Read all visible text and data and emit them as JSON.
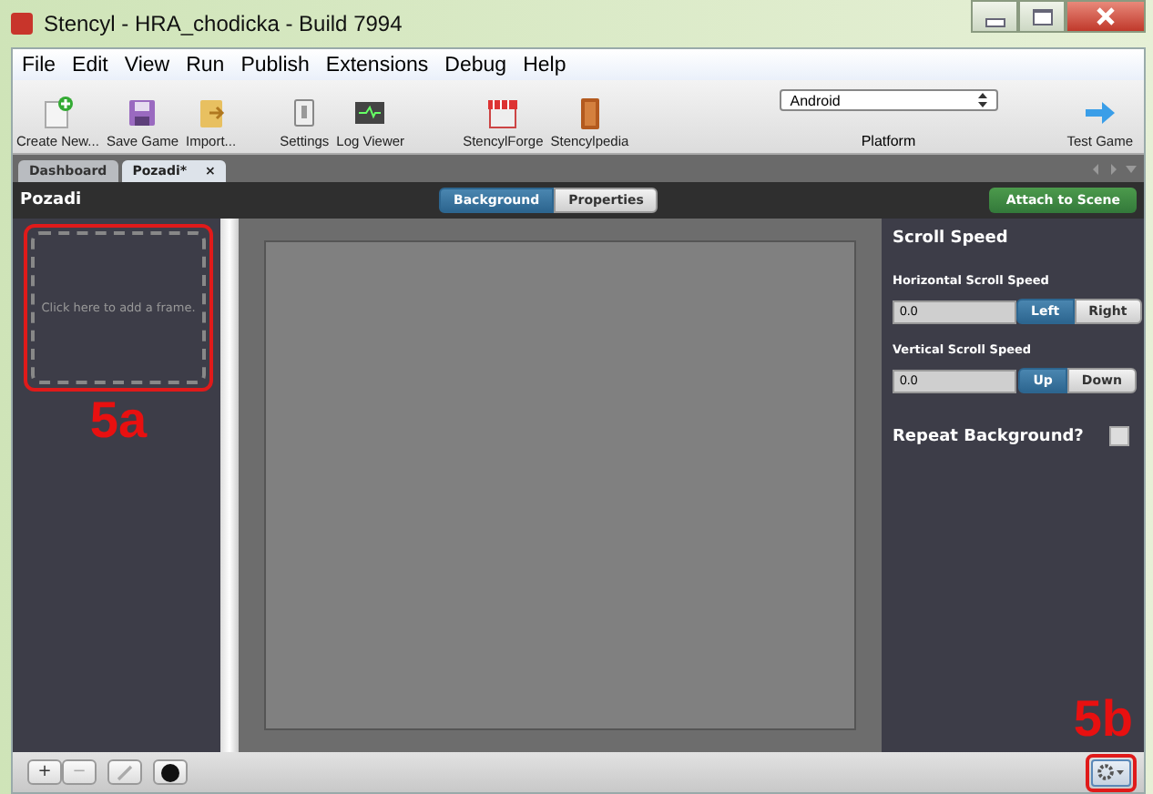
{
  "window": {
    "title": "Stencyl - HRA_chodicka - Build 7994"
  },
  "menu": [
    "File",
    "Edit",
    "View",
    "Run",
    "Publish",
    "Extensions",
    "Debug",
    "Help"
  ],
  "toolbar": [
    {
      "label": "Create New...",
      "kind": "new"
    },
    {
      "label": "Save Game",
      "kind": "save"
    },
    {
      "label": "Import...",
      "kind": "import"
    },
    {
      "label": "Settings",
      "kind": "settings"
    },
    {
      "label": "Log Viewer",
      "kind": "log"
    },
    {
      "label": "StencylForge",
      "kind": "forge"
    },
    {
      "label": "Stencylpedia",
      "kind": "book"
    }
  ],
  "platform": {
    "value": "Android",
    "label": "Platform"
  },
  "test_game": "Test Game",
  "tabs": [
    {
      "label": "Dashboard",
      "selected": false
    },
    {
      "label": "Pozadi*",
      "selected": true,
      "close": "×"
    }
  ],
  "header": {
    "title": "Pozadi",
    "views": [
      {
        "label": "Background",
        "selected": true
      },
      {
        "label": "Properties",
        "selected": false
      }
    ],
    "attach": "Attach to Scene"
  },
  "frames": {
    "placeholder": "Click here to add a frame."
  },
  "properties": {
    "title": "Scroll Speed",
    "horizontal": {
      "label": "Horizontal Scroll Speed",
      "value": "0.0",
      "options": [
        {
          "label": "Left",
          "selected": true
        },
        {
          "label": "Right",
          "selected": false
        }
      ]
    },
    "vertical": {
      "label": "Vertical Scroll Speed",
      "value": "0.0",
      "options": [
        {
          "label": "Up",
          "selected": true
        },
        {
          "label": "Down",
          "selected": false
        }
      ]
    },
    "repeat": {
      "label": "Repeat Background?",
      "checked": false
    }
  },
  "bottom_tools": [
    {
      "label": "+",
      "kind": "add"
    },
    {
      "label": "−",
      "kind": "remove"
    },
    {
      "kind": "pencil"
    },
    {
      "kind": "color"
    }
  ],
  "annotations": [
    {
      "label": "5a"
    },
    {
      "label": "5b"
    }
  ]
}
